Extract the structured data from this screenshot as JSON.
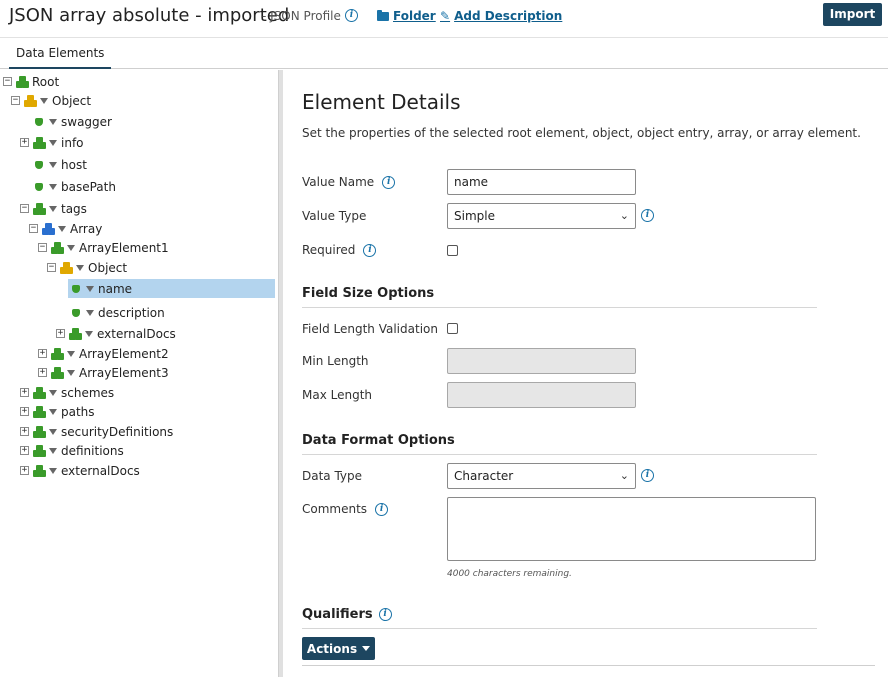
{
  "header": {
    "title": "JSON array absolute - imported",
    "subtitle": "- JSON Profile",
    "folder_link": "Folder",
    "add_description_link": "Add Description",
    "import_button": "Import"
  },
  "tabs": [
    {
      "label": "Data Elements"
    }
  ],
  "tree": {
    "nodes": [
      {
        "label": "Root"
      },
      {
        "label": "Object"
      },
      {
        "label": "swagger"
      },
      {
        "label": "info"
      },
      {
        "label": "host"
      },
      {
        "label": "basePath"
      },
      {
        "label": "tags"
      },
      {
        "label": "Array"
      },
      {
        "label": "ArrayElement1"
      },
      {
        "label": "Object"
      },
      {
        "label": "name"
      },
      {
        "label": "description"
      },
      {
        "label": "externalDocs"
      },
      {
        "label": "ArrayElement2"
      },
      {
        "label": "ArrayElement3"
      },
      {
        "label": "schemes"
      },
      {
        "label": "paths"
      },
      {
        "label": "securityDefinitions"
      },
      {
        "label": "definitions"
      },
      {
        "label": "externalDocs"
      }
    ]
  },
  "details": {
    "title": "Element Details",
    "description": "Set the properties of the selected root element, object, object entry, array, or array element.",
    "value_name_label": "Value Name",
    "value_name_value": "name",
    "value_type_label": "Value Type",
    "value_type_value": "Simple",
    "required_label": "Required",
    "field_size_section": "Field Size Options",
    "field_length_validation_label": "Field Length Validation",
    "min_length_label": "Min Length",
    "max_length_label": "Max Length",
    "data_format_section": "Data Format Options",
    "data_type_label": "Data Type",
    "data_type_value": "Character",
    "comments_label": "Comments",
    "remaining_text": "4000 characters remaining.",
    "qualifiers_section": "Qualifiers",
    "actions_button": "Actions"
  },
  "colors": {
    "primary_button": "#1d4660",
    "link": "#0f5e8c",
    "selected_row": "#b3d4ee",
    "object_icon": "#e0a800",
    "entry_icon": "#3a9b2a",
    "array_icon": "#2a6fcf"
  }
}
